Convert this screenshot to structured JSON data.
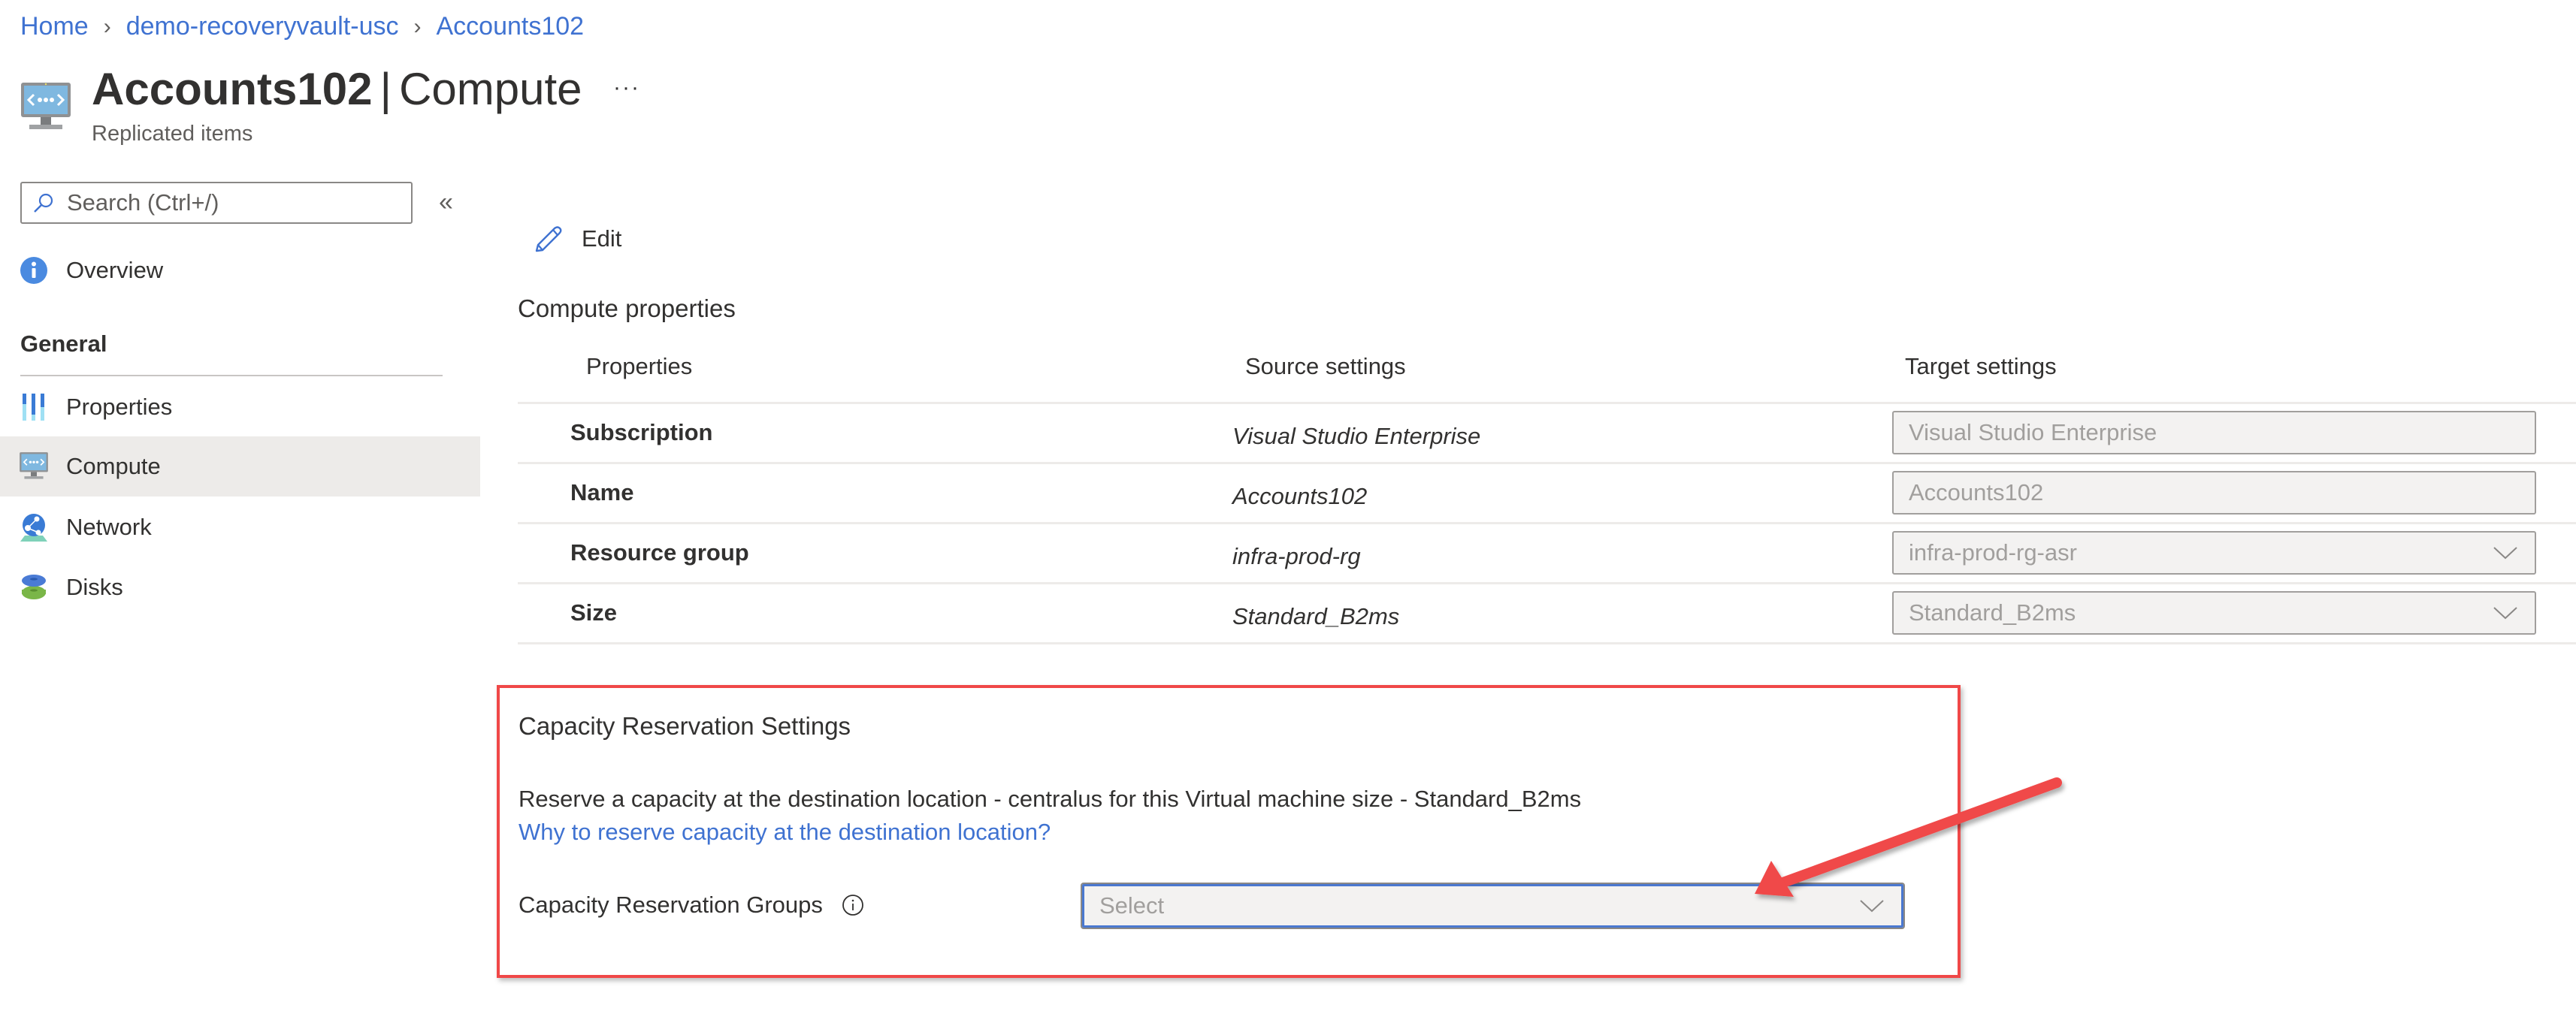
{
  "breadcrumb": [
    {
      "label": "Home"
    },
    {
      "label": "demo-recoveryvault-usc"
    },
    {
      "label": "Accounts102"
    }
  ],
  "header": {
    "resource_name": "Accounts102",
    "separator": "|",
    "section": "Compute",
    "subtitle": "Replicated items",
    "more_label": "···",
    "icon": "virtual-machine-icon"
  },
  "sidebar": {
    "search_placeholder": "Search (Ctrl+/)",
    "collapse_label": "«",
    "items_top": [
      {
        "label": "Overview",
        "icon": "info-icon"
      }
    ],
    "group_label": "General",
    "items": [
      {
        "label": "Properties",
        "icon": "properties-icon",
        "active": false
      },
      {
        "label": "Compute",
        "icon": "virtual-machine-icon",
        "active": true
      },
      {
        "label": "Network",
        "icon": "network-icon",
        "active": false
      },
      {
        "label": "Disks",
        "icon": "disks-icon",
        "active": false
      }
    ]
  },
  "toolbar": {
    "edit_label": "Edit"
  },
  "compute_properties": {
    "title": "Compute properties",
    "columns": [
      "Properties",
      "Source settings",
      "Target settings"
    ],
    "rows": [
      {
        "property": "Subscription",
        "source": "Visual Studio Enterprise",
        "target": "Visual Studio Enterprise",
        "target_type": "text"
      },
      {
        "property": "Name",
        "source": "Accounts102",
        "target": "Accounts102",
        "target_type": "text"
      },
      {
        "property": "Resource group",
        "source": "infra-prod-rg",
        "target": "infra-prod-rg-asr",
        "target_type": "dropdown"
      },
      {
        "property": "Size",
        "source": "Standard_B2ms",
        "target": "Standard_B2ms",
        "target_type": "dropdown"
      }
    ]
  },
  "capacity_reservation": {
    "title": "Capacity Reservation Settings",
    "description": "Reserve a capacity at the destination location - centralus for this Virtual machine size - Standard_B2ms",
    "link": "Why to reserve capacity at the destination location?",
    "groups_label": "Capacity Reservation Groups",
    "groups_placeholder": "Select"
  },
  "colors": {
    "link": "#3f72d1",
    "annotation_red": "#f04848",
    "active_nav_bg": "#edebe9",
    "disabled_input_bg": "#f3f2f1",
    "focus_border": "#4a78d0"
  }
}
